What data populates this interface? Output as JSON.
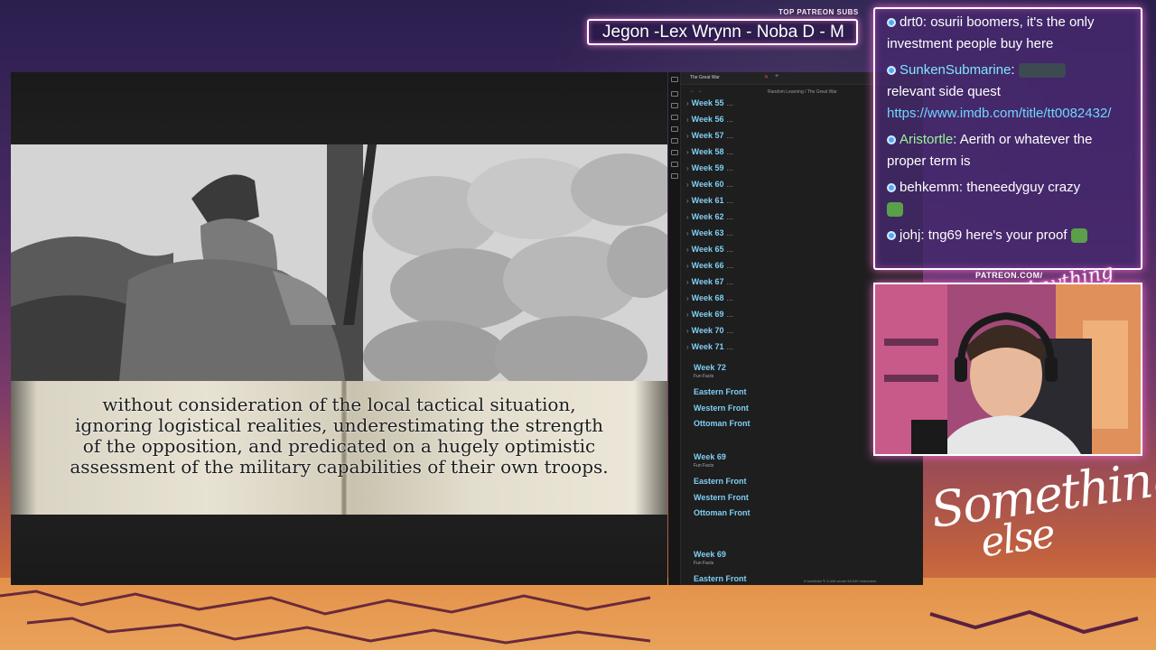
{
  "overlay": {
    "patreon_label": "TOP PATREON SUBS",
    "patreon_ticker": "Jegon -Lex Wrynn -  Noba D - M",
    "patreon_url": "PATREON.COM/",
    "logo_small": "Anything else?",
    "logo_line1": "Something",
    "logo_line2": "else"
  },
  "video": {
    "caption_lines": [
      "without consideration of the local tactical situation,",
      "ignoring logistical realities, underestimating the strength",
      "of the opposition, and predicated on a hugely optimistic",
      "assessment of the military capabilities of their own troops."
    ]
  },
  "app": {
    "tab_title": "The Great War",
    "nav_arrows": "← →",
    "breadcrumb": "Random Learning  /  The Great War",
    "status_bar": "0 backlinks   ✎  5,446 words   58,040 characters",
    "collapsed_weeks": [
      "Week 55",
      "Week 56",
      "Week 57",
      "Week 58",
      "Week 59",
      "Week 60",
      "Week 61",
      "Week 62",
      "Week 63",
      "Week 65",
      "Week 66",
      "Week 67",
      "Week 68",
      "Week 69",
      "Week 70",
      "Week 71"
    ],
    "ellipsis": "...",
    "chevron": "›",
    "section1": {
      "week": "Week 72",
      "sub": "Fun Facts",
      "fronts": [
        "Eastern Front",
        "Western Front",
        "Ottoman Front"
      ]
    },
    "section2": {
      "week": "Week 69",
      "sub": "Fun Facts",
      "fronts": [
        "Eastern Front",
        "Western Front",
        "Ottoman Front"
      ]
    },
    "section3": {
      "week": "Week 69",
      "sub": "Fun Facts",
      "fronts": [
        "Eastern Front"
      ]
    }
  },
  "chat": {
    "messages": [
      {
        "user": "drt0",
        "text": ": osurii boomers, it's the only investment people buy here"
      },
      {
        "user": "SunkenSubmarine",
        "text": ":",
        "line2": "relevant side quest",
        "link": "https://www.imdb.com/title/tt0082432/"
      },
      {
        "user": "Aristortle",
        "text": ": Aerith or whatever the proper term is"
      },
      {
        "user": "behkemm",
        "text": ": theneedyguy crazy"
      },
      {
        "user": "johj",
        "text": ": tng69 here's your proof"
      }
    ]
  },
  "colors": {
    "link_blue": "#7fcff5",
    "chat_border_glow": "#ff6edc",
    "chat_bg": "#46286e"
  }
}
